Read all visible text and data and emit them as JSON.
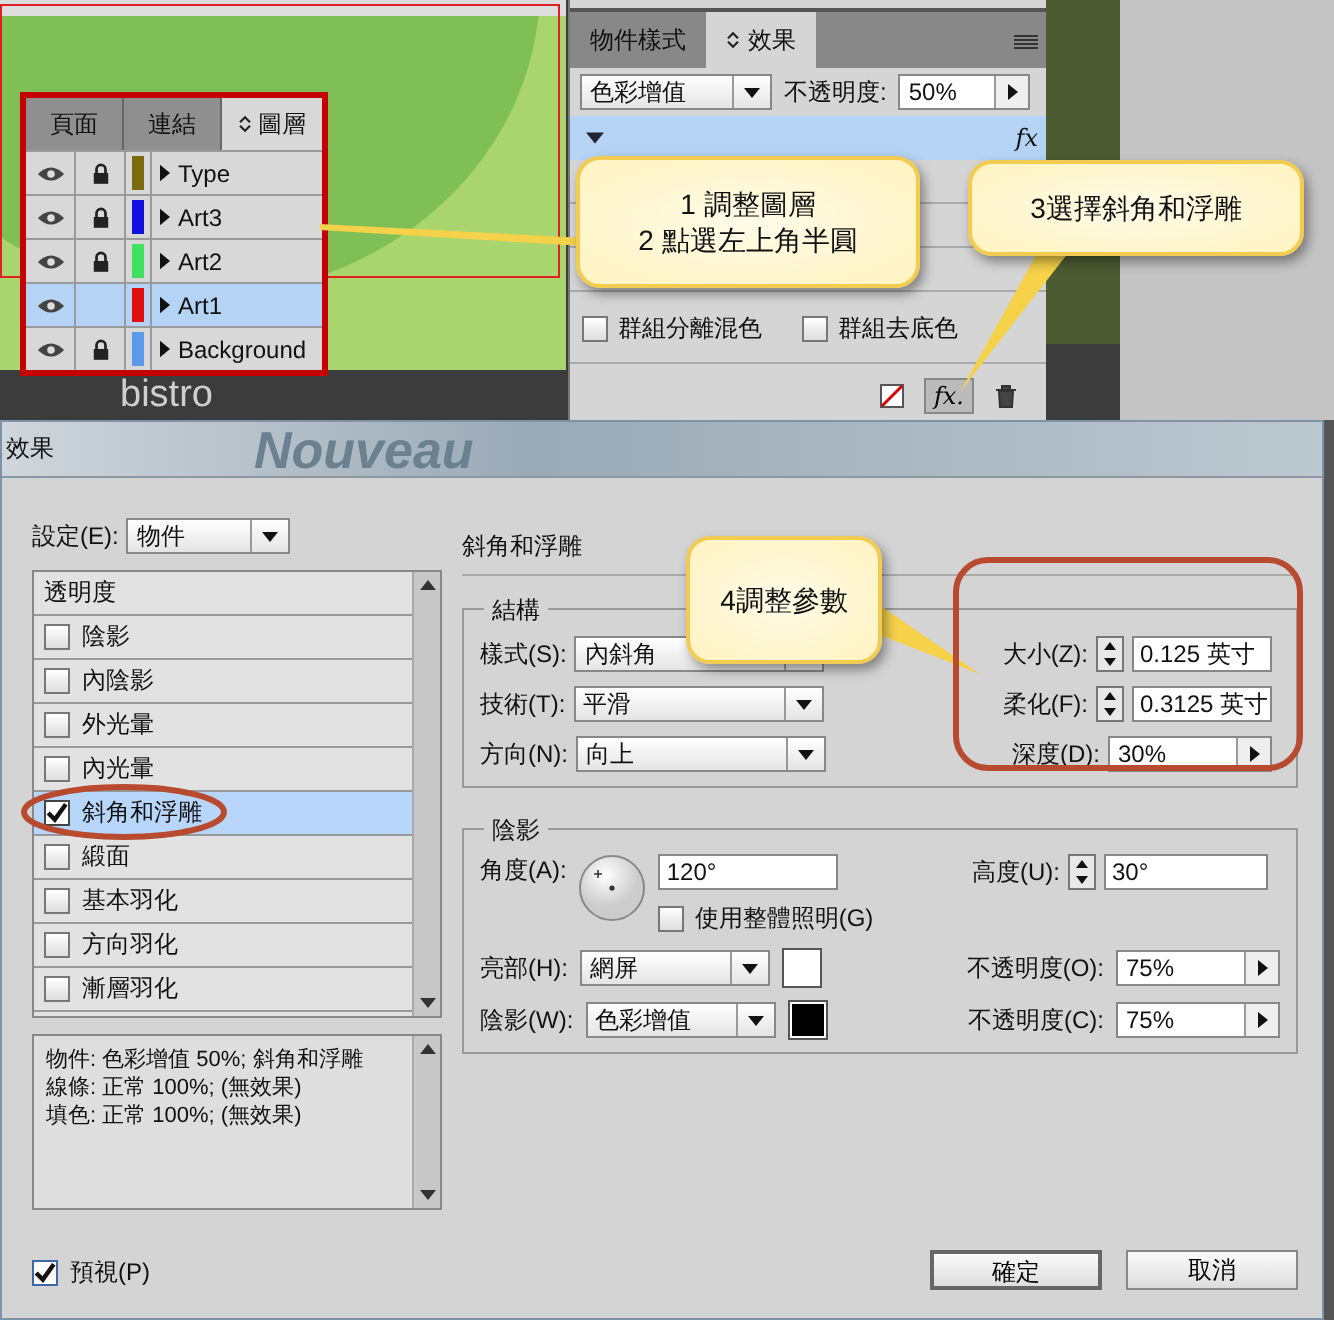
{
  "canvas": {
    "background_text": [
      "bistro",
      "Nouveau"
    ]
  },
  "layers_panel": {
    "tabs": [
      {
        "label": "頁面",
        "selected": false
      },
      {
        "label": "連結",
        "selected": false
      },
      {
        "label": "圖層",
        "selected": true
      }
    ],
    "layers": [
      {
        "name": "Type",
        "color": "#7a6a10",
        "locked": true,
        "selected": false
      },
      {
        "name": "Art3",
        "color": "#1010e0",
        "locked": true,
        "selected": false
      },
      {
        "name": "Art2",
        "color": "#40e060",
        "locked": true,
        "selected": false
      },
      {
        "name": "Art1",
        "color": "#e01010",
        "locked": false,
        "selected": true
      },
      {
        "name": "Background",
        "color": "#5a9ae8",
        "locked": true,
        "selected": false
      }
    ]
  },
  "effects_panel": {
    "tabs": [
      {
        "label": "物件樣式",
        "selected": false
      },
      {
        "label": "效果",
        "selected": true
      }
    ],
    "blend_mode": "色彩增值",
    "opacity_label": "不透明度:",
    "opacity": "50%",
    "effect_badge": "fx",
    "checkboxes": [
      {
        "label": "群組分離混色",
        "checked": false
      },
      {
        "label": "群組去底色",
        "checked": false
      }
    ],
    "fx_button": "fx."
  },
  "callouts": [
    {
      "lines": [
        "1 調整圖層",
        "2 點選左上角半圓"
      ]
    },
    {
      "lines": [
        "3選擇斜角和浮雕"
      ]
    },
    {
      "lines": [
        "4調整參數"
      ]
    }
  ],
  "dialog": {
    "title": "效果",
    "settings_label": "設定(E):",
    "settings_value": "物件",
    "effects": [
      {
        "kind": "header",
        "label": "透明度",
        "selected": false
      },
      {
        "kind": "option",
        "label": "陰影",
        "checked": false,
        "selected": false
      },
      {
        "kind": "option",
        "label": "內陰影",
        "checked": false,
        "selected": false
      },
      {
        "kind": "option",
        "label": "外光暈",
        "checked": false,
        "selected": false
      },
      {
        "kind": "option",
        "label": "內光暈",
        "checked": false,
        "selected": false
      },
      {
        "kind": "option",
        "label": "斜角和浮雕",
        "checked": true,
        "selected": true
      },
      {
        "kind": "option",
        "label": "緞面",
        "checked": false,
        "selected": false
      },
      {
        "kind": "option",
        "label": "基本羽化",
        "checked": false,
        "selected": false
      },
      {
        "kind": "option",
        "label": "方向羽化",
        "checked": false,
        "selected": false
      },
      {
        "kind": "option",
        "label": "漸層羽化",
        "checked": false,
        "selected": false
      }
    ],
    "summary": [
      "物件: 色彩增值 50%; 斜角和浮雕",
      "線條: 正常 100%; (無效果)",
      "填色: 正常 100%; (無效果)"
    ],
    "preview": {
      "label": "預視(P)",
      "checked": true
    },
    "section_title": "斜角和浮雕",
    "structure": {
      "title": "結構",
      "style_label": "樣式(S):",
      "style": "內斜角",
      "technique_label": "技術(T):",
      "technique": "平滑",
      "direction_label": "方向(N):",
      "direction": "向上",
      "size_label": "大小(Z):",
      "size": "0.125 英寸",
      "soften_label": "柔化(F):",
      "soften": "0.3125 英寸",
      "depth_label": "深度(D):",
      "depth": "30%"
    },
    "shading": {
      "title": "陰影",
      "angle_label": "角度(A):",
      "angle": "120°",
      "altitude_label": "高度(U):",
      "altitude": "30°",
      "global_light": {
        "label": "使用整體照明(G)",
        "checked": false
      },
      "highlight_label": "亮部(H):",
      "highlight_mode": "網屏",
      "highlight_opacity_label": "不透明度(O):",
      "highlight_opacity": "75%",
      "shadow_label": "陰影(W):",
      "shadow_mode": "色彩增值",
      "shadow_opacity_label": "不透明度(C):",
      "shadow_opacity": "75%"
    },
    "buttons": [
      "確定",
      "取消"
    ]
  }
}
